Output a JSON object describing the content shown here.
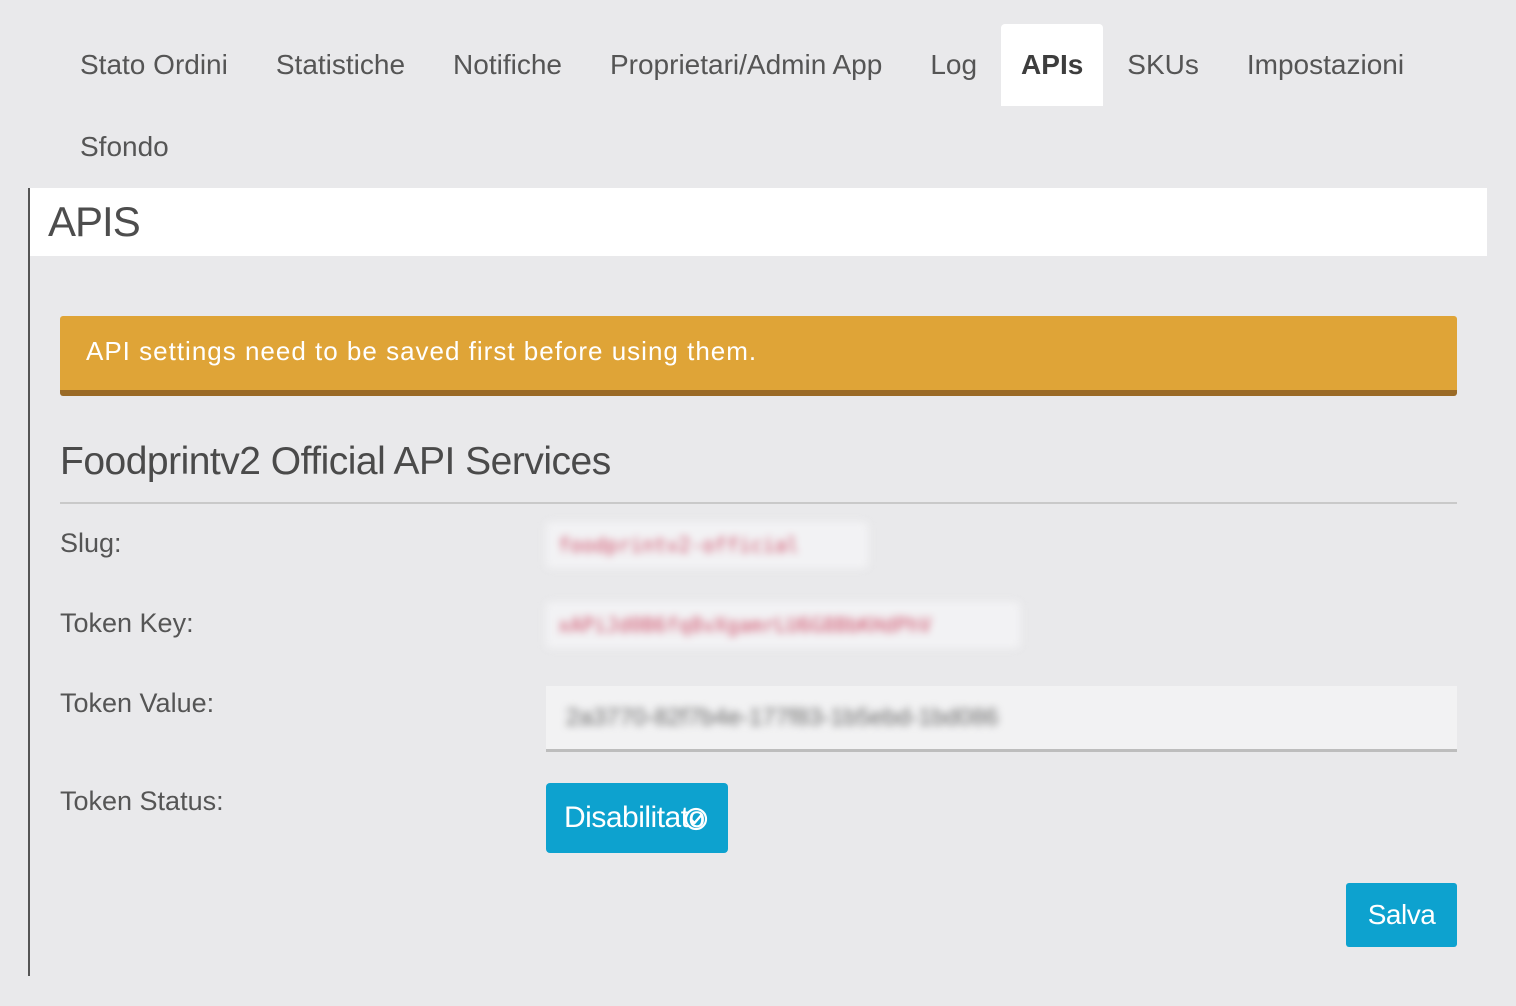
{
  "tabs": [
    {
      "label": "Stato Ordini",
      "active": false
    },
    {
      "label": "Statistiche",
      "active": false
    },
    {
      "label": "Notifiche",
      "active": false
    },
    {
      "label": "Proprietari/Admin App",
      "active": false
    },
    {
      "label": "Log",
      "active": false
    },
    {
      "label": "APIs",
      "active": true
    },
    {
      "label": "SKUs",
      "active": false
    },
    {
      "label": "Impostazioni",
      "active": false
    },
    {
      "label": "Sfondo",
      "active": false
    }
  ],
  "panel": {
    "title": "APIS"
  },
  "alert": {
    "message": "API settings need to be saved first before using them.",
    "color": "#dfa437"
  },
  "section": {
    "title": "Foodprintv2 Official API Services",
    "fields": {
      "slug_label": "Slug:",
      "slug_value": "foodprintv2-official",
      "token_key_label": "Token Key:",
      "token_key_value": "xAPiJd0B6fq8vXgamrLU6G8BbKHdPhV",
      "token_value_label": "Token Value:",
      "token_value_value": "2a3770-82f7b4e-177f83-1b5ebd-1bd086",
      "token_status_label": "Token Status:",
      "token_status_value": "Disabilitato"
    }
  },
  "actions": {
    "save_label": "Salva"
  },
  "colors": {
    "accent": "#0da2cf",
    "background": "#e9e9eb",
    "warning": "#dfa437"
  }
}
